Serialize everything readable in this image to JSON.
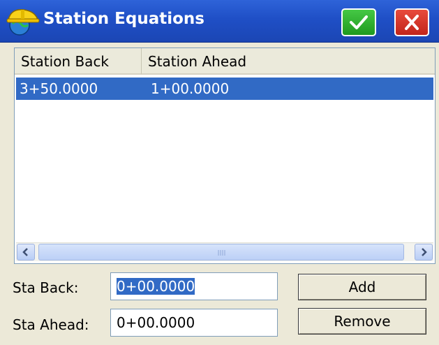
{
  "window": {
    "title": "Station Equations",
    "ok_icon": "checkmark-icon",
    "close_icon": "close-icon",
    "app_icon": "hardhat-globe-icon"
  },
  "table": {
    "columns": [
      "Station Back",
      "Station Ahead"
    ],
    "rows": [
      {
        "back": "3+50.0000",
        "ahead": "1+00.0000",
        "selected": true
      }
    ],
    "scroll_left_icon": "chevron-left-icon",
    "scroll_right_icon": "chevron-right-icon"
  },
  "form": {
    "sta_back_label": "Sta Back:",
    "sta_back_value": "0+00.0000",
    "sta_ahead_label": "Sta Ahead:",
    "sta_ahead_value": "0+00.0000",
    "add_label": "Add",
    "remove_label": "Remove"
  },
  "colors": {
    "titlebar": "#1f4fc6",
    "selection": "#316ac5",
    "ok_button": "#2aa82a",
    "close_button": "#d7301f"
  }
}
